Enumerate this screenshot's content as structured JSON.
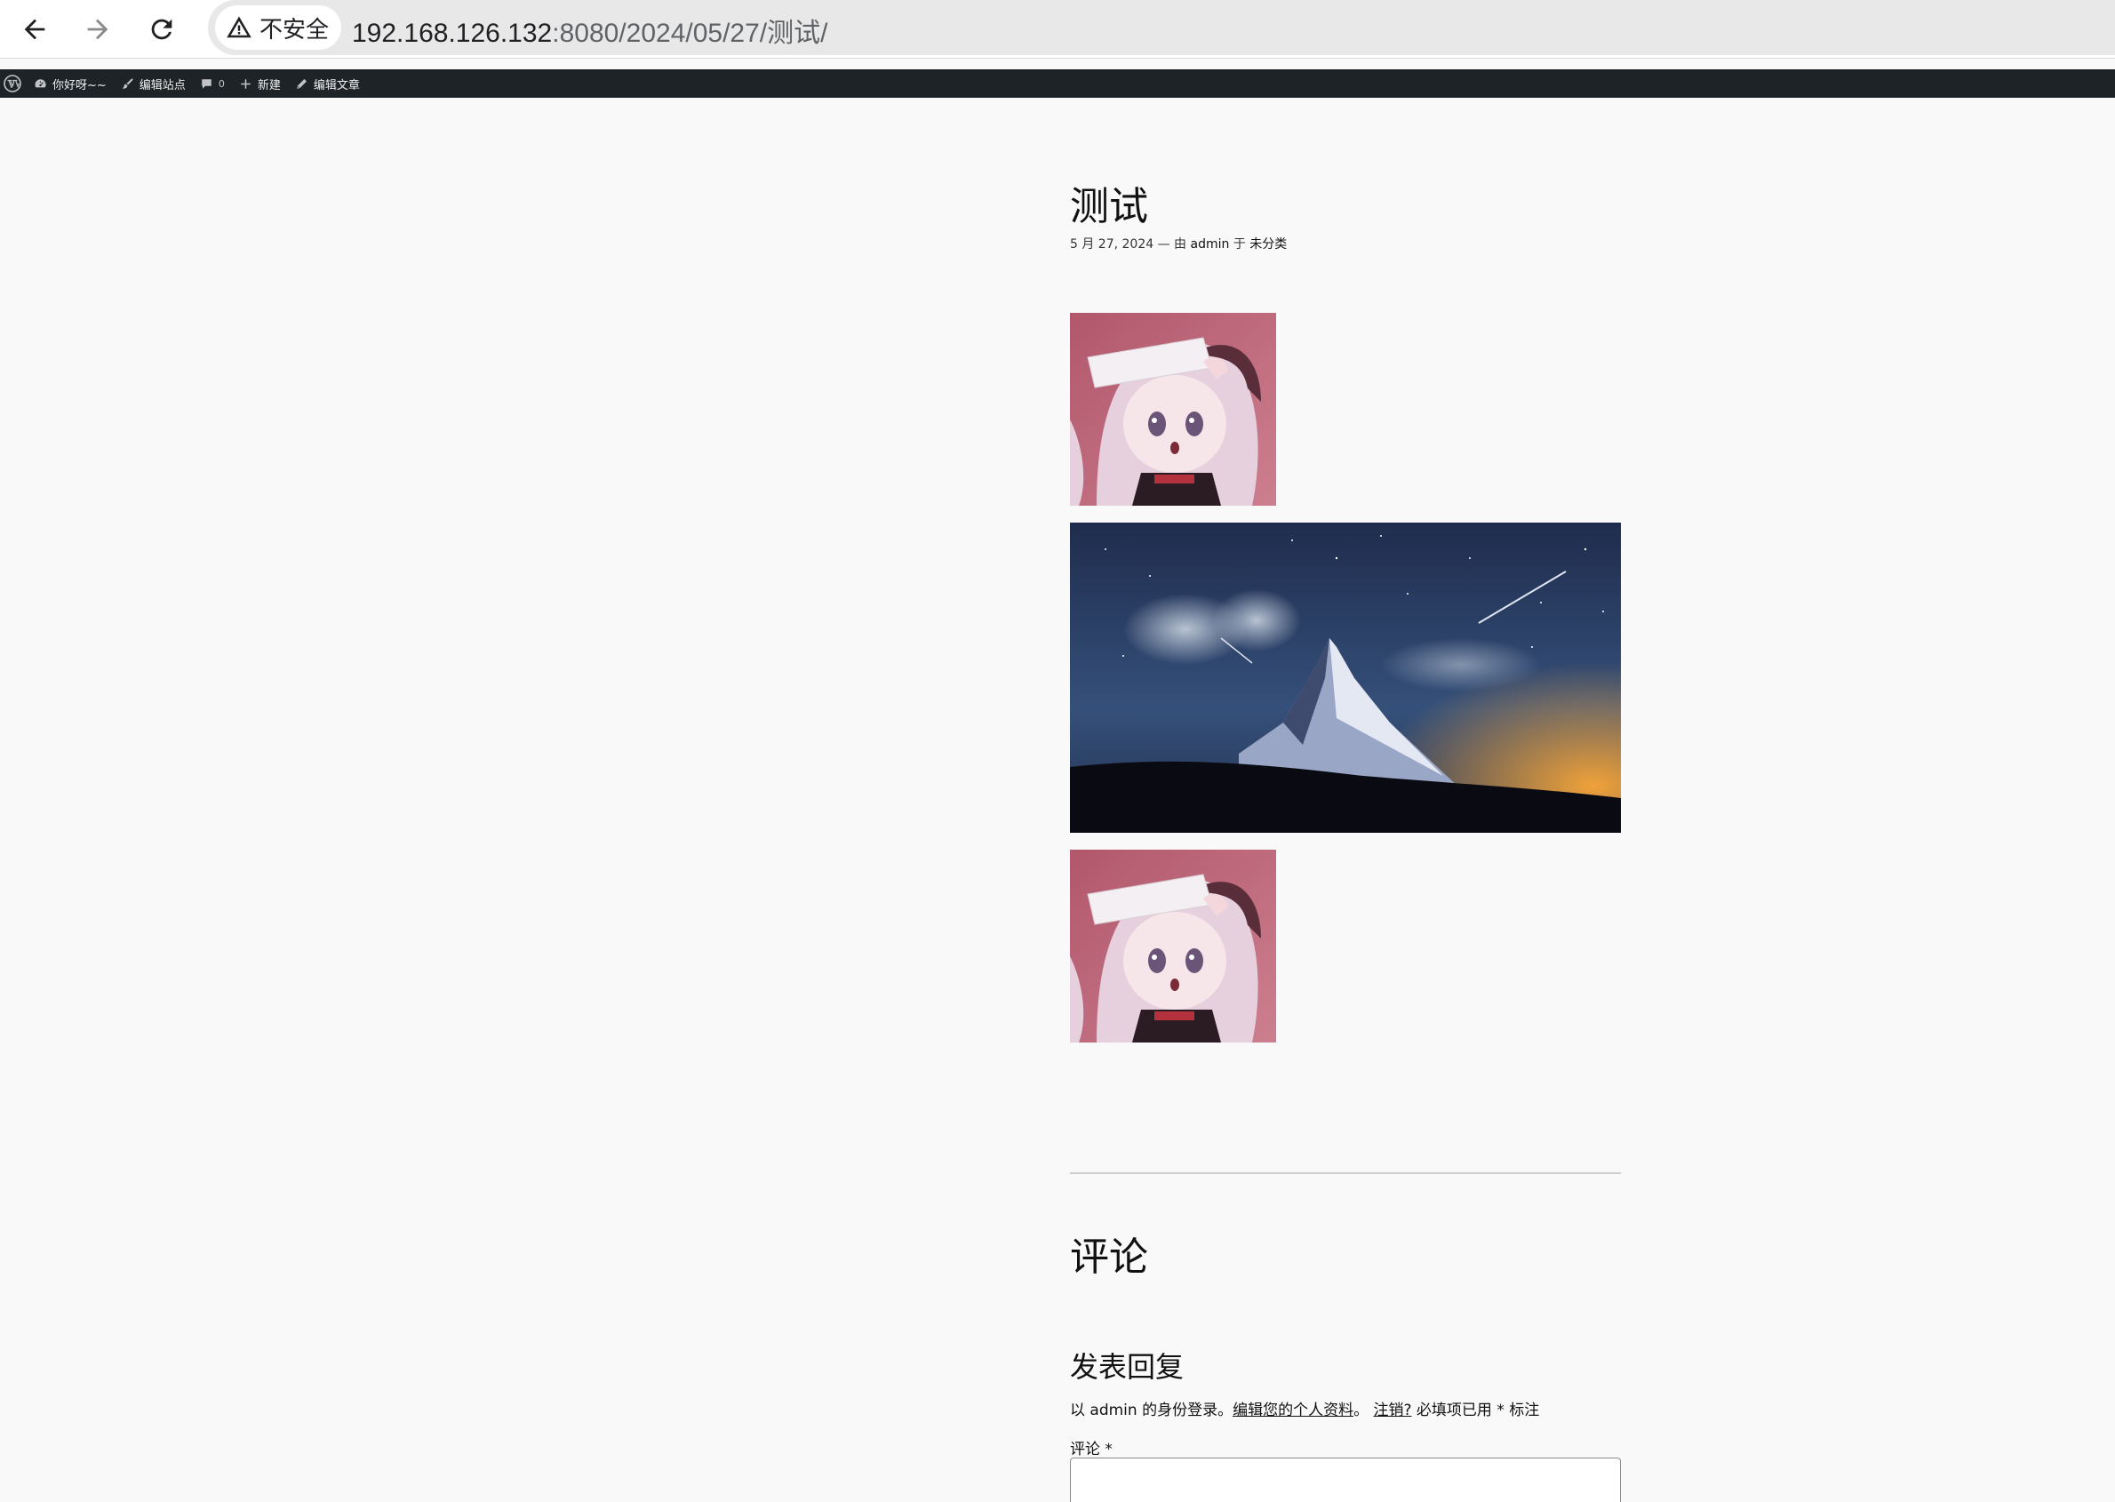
{
  "browser": {
    "security_label": "不安全",
    "url_host": "192.168.126.132",
    "url_path": ":8080/2024/05/27/测试/",
    "icons": [
      "back-arrow-icon",
      "forward-arrow-icon",
      "reload-icon",
      "warning-icon"
    ]
  },
  "admin_bar": {
    "site_name": "你好呀~~",
    "edit_site": "编辑站点",
    "comments_count": "0",
    "new_label": "新建",
    "edit_post": "编辑文章",
    "colors": {
      "background": "#1d2327",
      "text": "#f0f0f1"
    }
  },
  "post": {
    "title": "测试",
    "date": "5 月 27, 2024",
    "meta_sep": "— 由",
    "author": "admin",
    "meta_in": "于",
    "category": "未分类"
  },
  "comments": {
    "title": "评论",
    "reply_title": "发表回复",
    "logged_in_prefix": "以 admin 的身份登录。",
    "edit_profile": "编辑您的个人资料",
    "sep": "。",
    "logout": "注销?",
    "required_note": "必填项已用 * 标注",
    "comment_label": "评论 *"
  }
}
